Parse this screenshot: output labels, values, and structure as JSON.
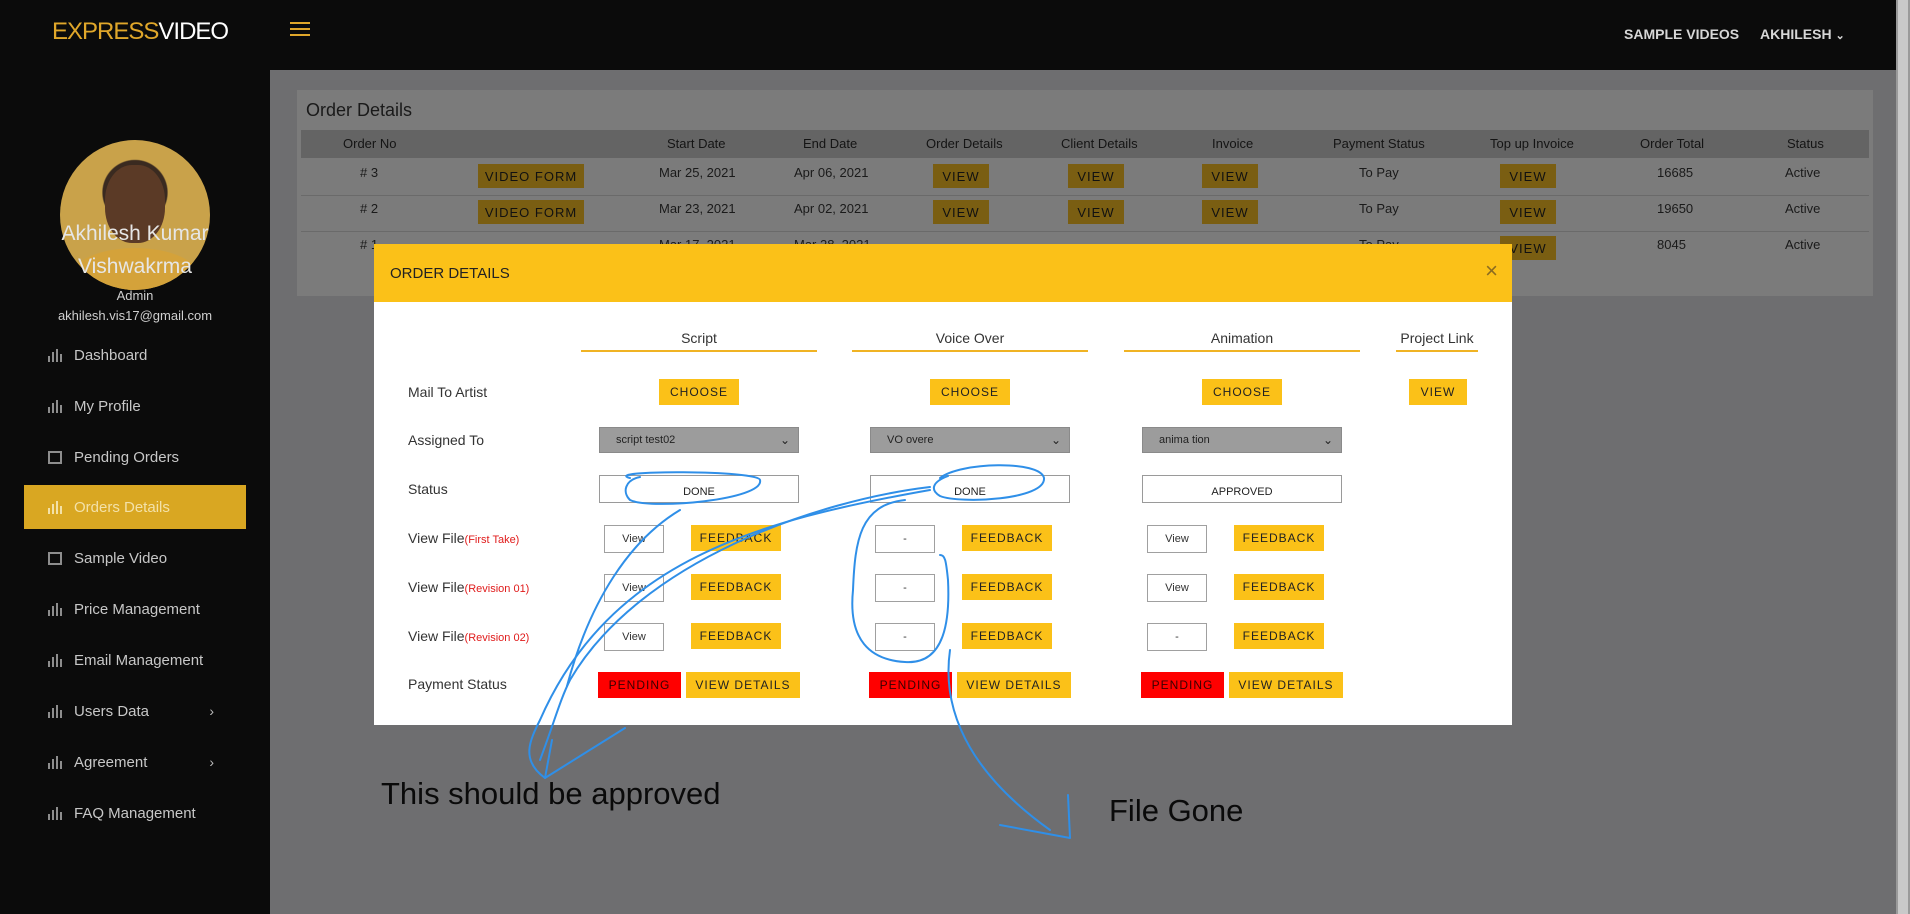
{
  "header": {
    "logo_part1": "EXPRESS",
    "logo_part2": "VIDEO",
    "sample_videos": "SAMPLE VIDEOS",
    "user_menu": "AKHILESH"
  },
  "sidebar": {
    "name_line1": "Akhilesh Kumar",
    "name_line2": "Vishwakrma",
    "role": "Admin",
    "email": "akhilesh.vis17@gmail.com",
    "items": [
      {
        "label": "Dashboard"
      },
      {
        "label": "My Profile"
      },
      {
        "label": "Pending Orders"
      },
      {
        "label": "Orders Details"
      },
      {
        "label": "Sample Video"
      },
      {
        "label": "Price Management"
      },
      {
        "label": "Email Management"
      },
      {
        "label": "Users Data"
      },
      {
        "label": "Agreement"
      },
      {
        "label": "FAQ Management"
      }
    ],
    "chevron": "›"
  },
  "orders": {
    "title": "Order Details",
    "columns": [
      "Order No",
      "Start Date",
      "End Date",
      "Order Details",
      "Client Details",
      "Invoice",
      "Payment Status",
      "Top up Invoice",
      "Order Total",
      "Status"
    ],
    "video_form": "VIDEO FORM",
    "view": "VIEW",
    "rows": [
      {
        "no": "# 3",
        "start": "Mar 25, 2021",
        "end": "Apr 06, 2021",
        "payment": "To Pay",
        "total": "16685",
        "status": "Active"
      },
      {
        "no": "# 2",
        "start": "Mar 23, 2021",
        "end": "Apr 02, 2021",
        "payment": "To Pay",
        "total": "19650",
        "status": "Active"
      },
      {
        "no": "# 1",
        "start": "Mar 17, 2021",
        "end": "Mar 28, 2021",
        "payment": "To Pay",
        "total": "8045",
        "status": "Active"
      }
    ]
  },
  "modal": {
    "title": "ORDER DETAILS",
    "close": "×",
    "columns": [
      "Script",
      "Voice Over",
      "Animation",
      "Project Link"
    ],
    "labels": {
      "mail": "Mail To Artist",
      "assigned": "Assigned To",
      "status": "Status",
      "view_file": "View File",
      "first_take": "(First Take)",
      "revision1": "(Revision 01)",
      "revision2": "(Revision 02)",
      "payment": "Payment Status"
    },
    "choose": "CHOOSE",
    "view": "VIEW",
    "feedback": "FEEDBACK",
    "pending": "PENDING",
    "view_details": "VIEW DETAILS",
    "assigned": [
      "script test02",
      "VO overe",
      "anima tion"
    ],
    "status": [
      "DONE",
      "DONE",
      "APPROVED"
    ],
    "files": {
      "script": [
        "View",
        "View",
        "View"
      ],
      "voice": [
        "-",
        "-",
        "-"
      ],
      "animation": [
        "View",
        "View",
        "-"
      ]
    }
  },
  "annotations": {
    "left_note": "This should be approved",
    "right_note": "File Gone",
    "pen_color": "#2f8fe8"
  },
  "colors": {
    "accent": "#fbc118",
    "danger": "#ff0000",
    "sidebar_active": "#d9a722"
  }
}
